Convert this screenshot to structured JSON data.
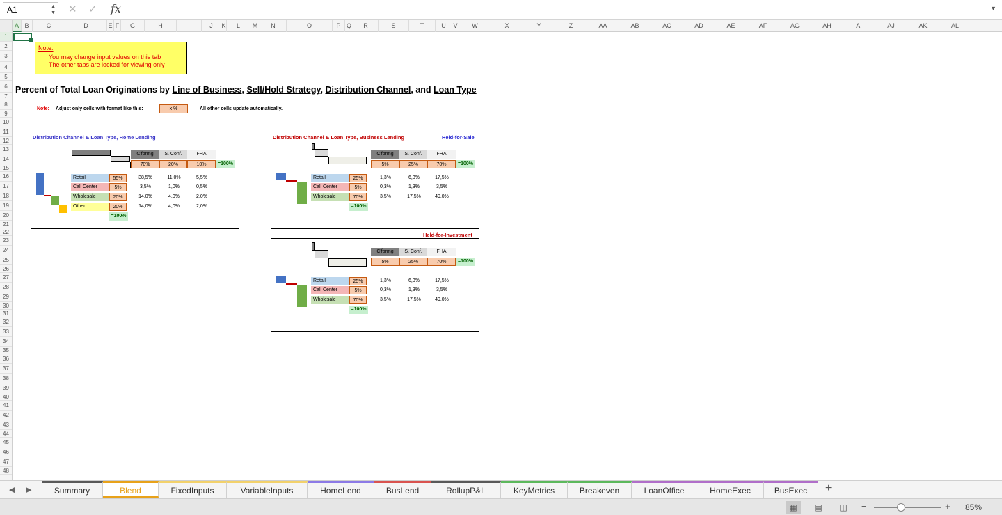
{
  "formula_bar": {
    "cell_ref": "A1",
    "cancel_icon": "✕",
    "confirm_icon": "✓",
    "fx_label": "fx",
    "formula": "",
    "dropdown_icon": "▼"
  },
  "columns": [
    "A",
    "B",
    "C",
    "D",
    "E",
    "F",
    "G",
    "H",
    "I",
    "J",
    "K",
    "L",
    "M",
    "N",
    "O",
    "P",
    "Q",
    "R",
    "S",
    "T",
    "U",
    "V",
    "W",
    "X",
    "Y",
    "Z",
    "AA",
    "AB",
    "AC",
    "AD",
    "AE",
    "AF",
    "AG",
    "AH",
    "AI",
    "AJ",
    "AK",
    "AL"
  ],
  "rows": [
    "1",
    "2",
    "3",
    "4",
    "5",
    "6",
    "7",
    "8",
    "9",
    "10",
    "11",
    "12",
    "13",
    "14",
    "15",
    "16",
    "17",
    "18",
    "19",
    "20",
    "21",
    "22",
    "23",
    "24",
    "25",
    "26",
    "27",
    "28",
    "29",
    "30",
    "31",
    "32",
    "33",
    "34",
    "35",
    "36",
    "37",
    "38",
    "39",
    "40",
    "41",
    "42",
    "43",
    "44",
    "45",
    "46",
    "47",
    "48"
  ],
  "note_box": {
    "title": "Note:",
    "line1": "You may change input values on this tab",
    "line2": "The other tabs are locked for viewing only"
  },
  "main_title": {
    "prefix": "Percent of Total Loan Originations by ",
    "p1": "Line of Business",
    "sep1": ", ",
    "p2": "Sell/Hold Strategy",
    "sep2": ", ",
    "p3": "Distribution Channel",
    "sep3": ", and ",
    "p4": "Loan Type"
  },
  "format_note": {
    "label": "Note:",
    "text": "Adjust only cells with format like this:",
    "sample": "x %",
    "text2": "All other cells update automatically."
  },
  "home": {
    "title": "Distribution Channel & Loan Type, Home Lending",
    "headers": [
      "C'formg",
      "S. Conf.",
      "FHA"
    ],
    "type_pcts": [
      "70%",
      "20%",
      "10%"
    ],
    "sum": "=100%",
    "channels": [
      {
        "label": "Retail",
        "pct": "55%",
        "vals": [
          "38,5%",
          "11,0%",
          "5,5%"
        ]
      },
      {
        "label": "Call Center",
        "pct": "5%",
        "vals": [
          "3,5%",
          "1,0%",
          "0,5%"
        ]
      },
      {
        "label": "Wholesale",
        "pct": "20%",
        "vals": [
          "14,0%",
          "4,0%",
          "2,0%"
        ]
      },
      {
        "label": "Other",
        "pct": "20%",
        "vals": [
          "14,0%",
          "4,0%",
          "2,0%"
        ]
      }
    ],
    "channel_sum": "=100%"
  },
  "bus_hfs": {
    "title": "Distribution Channel & Loan Type, Business Lending",
    "subtitle": "Held-for-Sale",
    "headers": [
      "C'formg",
      "S. Conf.",
      "FHA"
    ],
    "type_pcts": [
      "5%",
      "25%",
      "70%"
    ],
    "sum": "=100%",
    "channels": [
      {
        "label": "Retail",
        "pct": "25%",
        "vals": [
          "1,3%",
          "6,3%",
          "17,5%"
        ]
      },
      {
        "label": "Call Center",
        "pct": "5%",
        "vals": [
          "0,3%",
          "1,3%",
          "3,5%"
        ]
      },
      {
        "label": "Wholesale",
        "pct": "70%",
        "vals": [
          "3,5%",
          "17,5%",
          "49,0%"
        ]
      }
    ],
    "channel_sum": "=100%"
  },
  "bus_hfi": {
    "subtitle": "Held-for-Investment",
    "headers": [
      "C'formg",
      "S. Conf.",
      "FHA"
    ],
    "type_pcts": [
      "5%",
      "25%",
      "70%"
    ],
    "sum": "=100%",
    "channels": [
      {
        "label": "Retail",
        "pct": "25%",
        "vals": [
          "1,3%",
          "6,3%",
          "17,5%"
        ]
      },
      {
        "label": "Call Center",
        "pct": "5%",
        "vals": [
          "0,3%",
          "1,3%",
          "3,5%"
        ]
      },
      {
        "label": "Wholesale",
        "pct": "70%",
        "vals": [
          "3,5%",
          "17,5%",
          "49,0%"
        ]
      }
    ],
    "channel_sum": "=100%"
  },
  "tabs": [
    {
      "label": "Summary",
      "color": "#595959"
    },
    {
      "label": "Blend",
      "color": "#e8a21a",
      "active": true
    },
    {
      "label": "FixedInputs",
      "color": "#f2d16b"
    },
    {
      "label": "VariableInputs",
      "color": "#f2d16b"
    },
    {
      "label": "HomeLend",
      "color": "#8c7ae6"
    },
    {
      "label": "BusLend",
      "color": "#d9534f"
    },
    {
      "label": "RollupP&L",
      "color": "#595959"
    },
    {
      "label": "KeyMetrics",
      "color": "#5cb85c"
    },
    {
      "label": "Breakeven",
      "color": "#5cb85c"
    },
    {
      "label": "LoanOffice",
      "color": "#b06ec9"
    },
    {
      "label": "HomeExec",
      "color": "#b06ec9"
    },
    {
      "label": "BusExec",
      "color": "#b06ec9"
    }
  ],
  "add_tab": "+",
  "status": {
    "zoom": "85%",
    "zoom_minus": "−",
    "zoom_plus": "+"
  },
  "colors": {
    "accent": "#217346",
    "active_tab": "#e8a21a",
    "note_yellow": "#ffff66",
    "note_red": "#e00000",
    "home_title": "#3a35c8",
    "bus_title": "#c00000",
    "hfs_title": "#1f1fd0",
    "input_orange": "#f8cbad",
    "sum_green": "#c6efce"
  }
}
